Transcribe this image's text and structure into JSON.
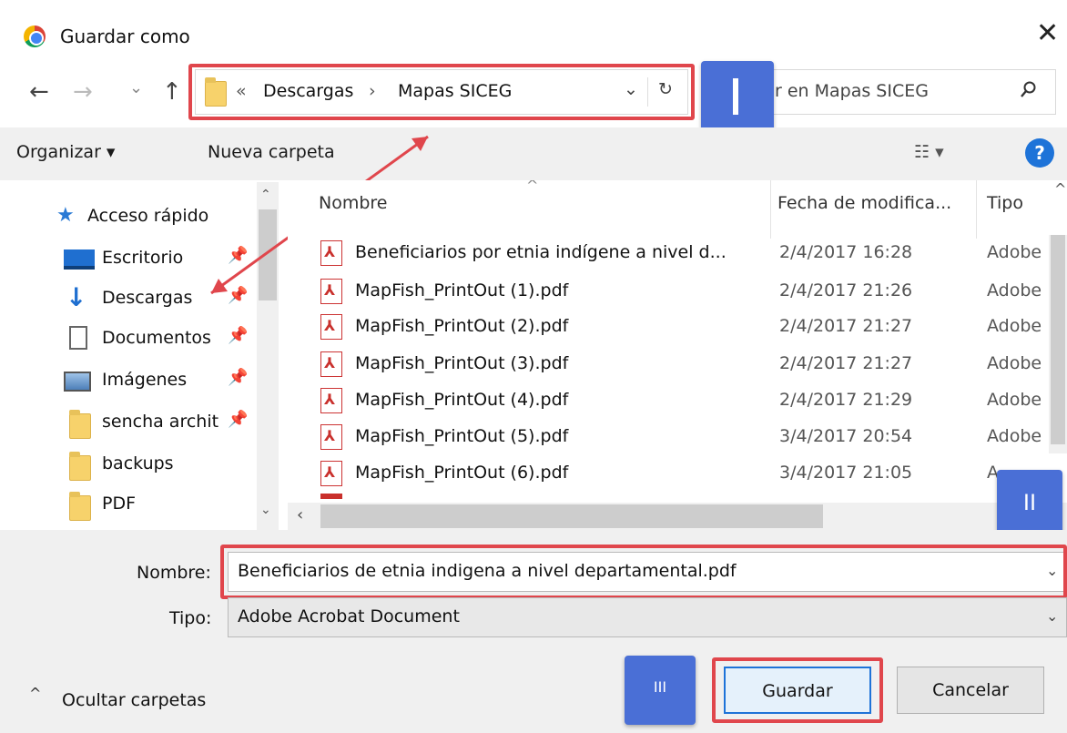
{
  "window": {
    "title": "Guardar como",
    "close_glyph": "✕"
  },
  "nav": {
    "back": "←",
    "forward": "→",
    "recent": "⌄",
    "up": "↑"
  },
  "address": {
    "prefix": "«",
    "crumbs": [
      "Descargas",
      "Mapas SICEG"
    ],
    "separator": "›",
    "dropdown": "⌄",
    "refresh": "↻"
  },
  "search": {
    "placeholder": "r en Mapas SICEG"
  },
  "toolbar": {
    "organize": "Organizar ▾",
    "new_folder": "Nueva carpeta",
    "view": "☷ ▾",
    "help": "?"
  },
  "sidebar": {
    "items": [
      {
        "label": "Acceso rápido",
        "icon": "star-icon",
        "pinned": false
      },
      {
        "label": "Escritorio",
        "icon": "desktop-icon",
        "pinned": true
      },
      {
        "label": "Descargas",
        "icon": "download-icon",
        "pinned": true
      },
      {
        "label": "Documentos",
        "icon": "documents-icon",
        "pinned": true
      },
      {
        "label": "Imágenes",
        "icon": "pictures-icon",
        "pinned": true
      },
      {
        "label": "sencha archit",
        "icon": "folder-icon",
        "pinned": true
      },
      {
        "label": "backups",
        "icon": "folder-icon",
        "pinned": false
      },
      {
        "label": "PDF",
        "icon": "folder-icon",
        "pinned": false
      }
    ]
  },
  "files": {
    "columns": {
      "name": "Nombre",
      "date": "Fecha de modifica...",
      "type": "Tipo"
    },
    "rows": [
      {
        "name": "Beneficiarios por etnia indígene a nivel d...",
        "date": "2/4/2017 16:28",
        "type": "Adobe"
      },
      {
        "name": "MapFish_PrintOut (1).pdf",
        "date": "2/4/2017 21:26",
        "type": "Adobe"
      },
      {
        "name": "MapFish_PrintOut (2).pdf",
        "date": "2/4/2017 21:27",
        "type": "Adobe"
      },
      {
        "name": "MapFish_PrintOut (3).pdf",
        "date": "2/4/2017 21:27",
        "type": "Adobe"
      },
      {
        "name": "MapFish_PrintOut (4).pdf",
        "date": "2/4/2017 21:29",
        "type": "Adobe"
      },
      {
        "name": "MapFish_PrintOut (5).pdf",
        "date": "3/4/2017 20:54",
        "type": "Adobe"
      },
      {
        "name": "MapFish_PrintOut (6).pdf",
        "date": "3/4/2017 21:05",
        "type": "A"
      }
    ]
  },
  "form": {
    "name_label": "Nombre:",
    "name_value": "Beneficiarios de etnia indigena a nivel departamental.pdf",
    "type_label": "Tipo:",
    "type_value": "Adobe Acrobat Document"
  },
  "footer": {
    "hide_folders": "Ocultar carpetas",
    "save": "Guardar",
    "cancel": "Cancelar"
  },
  "annotations": {
    "badge_1": "I",
    "badge_2": "II",
    "badge_3": "III"
  },
  "colors": {
    "highlight": "#e0464c",
    "badge": "#4a6fd6",
    "accent": "#1e73d8"
  }
}
